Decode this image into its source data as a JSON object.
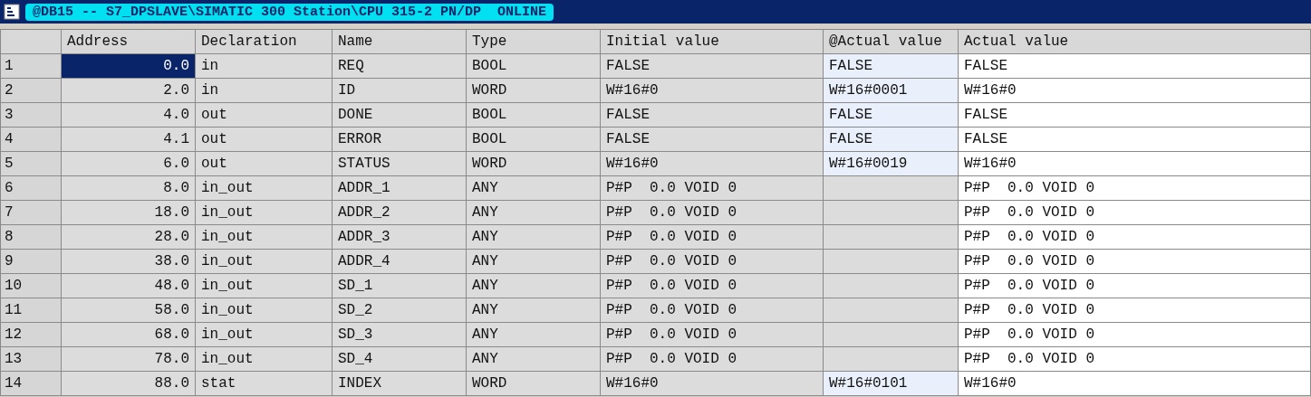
{
  "window": {
    "title": "@DB15 -- S7_DPSLAVE\\SIMATIC 300 Station\\CPU 315-2 PN/DP  ONLINE"
  },
  "table": {
    "columns": [
      "Address",
      "Declaration",
      "Name",
      "Type",
      "Initial value",
      "@Actual value",
      "Actual value"
    ],
    "rows": [
      {
        "number": "1",
        "address": "0.0",
        "declaration": "in",
        "name": "REQ",
        "type": "BOOL",
        "initial_value": "FALSE",
        "at_actual_value": "FALSE",
        "actual_value": "FALSE",
        "selected": true
      },
      {
        "number": "2",
        "address": "2.0",
        "declaration": "in",
        "name": "ID",
        "type": "WORD",
        "initial_value": "W#16#0",
        "at_actual_value": "W#16#0001",
        "actual_value": "W#16#0",
        "selected": false
      },
      {
        "number": "3",
        "address": "4.0",
        "declaration": "out",
        "name": "DONE",
        "type": "BOOL",
        "initial_value": "FALSE",
        "at_actual_value": "FALSE",
        "actual_value": "FALSE",
        "selected": false
      },
      {
        "number": "4",
        "address": "4.1",
        "declaration": "out",
        "name": "ERROR",
        "type": "BOOL",
        "initial_value": "FALSE",
        "at_actual_value": "FALSE",
        "actual_value": "FALSE",
        "selected": false
      },
      {
        "number": "5",
        "address": "6.0",
        "declaration": "out",
        "name": "STATUS",
        "type": "WORD",
        "initial_value": "W#16#0",
        "at_actual_value": "W#16#0019",
        "actual_value": "W#16#0",
        "selected": false
      },
      {
        "number": "6",
        "address": "8.0",
        "declaration": "in_out",
        "name": "ADDR_1",
        "type": "ANY",
        "initial_value": "P#P  0.0 VOID 0",
        "actual_value": "P#P  0.0 VOID 0",
        "selected": false
      },
      {
        "number": "7",
        "address": "18.0",
        "declaration": "in_out",
        "name": "ADDR_2",
        "type": "ANY",
        "initial_value": "P#P  0.0 VOID 0",
        "actual_value": "P#P  0.0 VOID 0",
        "selected": false
      },
      {
        "number": "8",
        "address": "28.0",
        "declaration": "in_out",
        "name": "ADDR_3",
        "type": "ANY",
        "initial_value": "P#P  0.0 VOID 0",
        "actual_value": "P#P  0.0 VOID 0",
        "selected": false
      },
      {
        "number": "9",
        "address": "38.0",
        "declaration": "in_out",
        "name": "ADDR_4",
        "type": "ANY",
        "initial_value": "P#P  0.0 VOID 0",
        "actual_value": "P#P  0.0 VOID 0",
        "selected": false
      },
      {
        "number": "10",
        "address": "48.0",
        "declaration": "in_out",
        "name": "SD_1",
        "type": "ANY",
        "initial_value": "P#P  0.0 VOID 0",
        "actual_value": "P#P  0.0 VOID 0",
        "selected": false
      },
      {
        "number": "11",
        "address": "58.0",
        "declaration": "in_out",
        "name": "SD_2",
        "type": "ANY",
        "initial_value": "P#P  0.0 VOID 0",
        "actual_value": "P#P  0.0 VOID 0",
        "selected": false
      },
      {
        "number": "12",
        "address": "68.0",
        "declaration": "in_out",
        "name": "SD_3",
        "type": "ANY",
        "initial_value": "P#P  0.0 VOID 0",
        "actual_value": "P#P  0.0 VOID 0",
        "selected": false
      },
      {
        "number": "13",
        "address": "78.0",
        "declaration": "in_out",
        "name": "SD_4",
        "type": "ANY",
        "initial_value": "P#P  0.0 VOID 0",
        "actual_value": "P#P  0.0 VOID 0",
        "selected": false
      },
      {
        "number": "14",
        "address": "88.0",
        "declaration": "stat",
        "name": "INDEX",
        "type": "WORD",
        "initial_value": "W#16#0",
        "at_actual_value": "W#16#0101",
        "actual_value": "W#16#0",
        "selected": false
      }
    ]
  }
}
